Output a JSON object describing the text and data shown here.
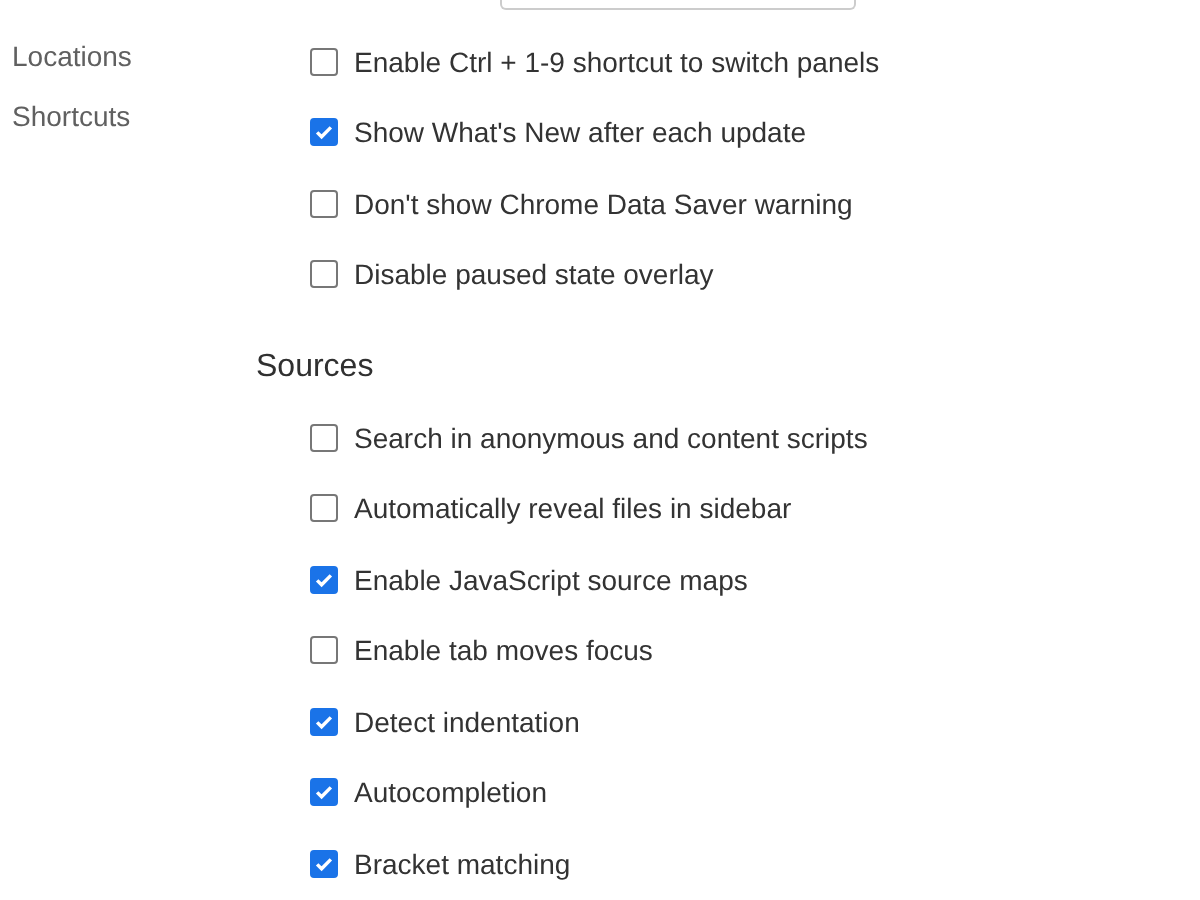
{
  "sidebar": {
    "items": [
      {
        "label": "Locations"
      },
      {
        "label": "Shortcuts"
      }
    ]
  },
  "sections": [
    {
      "options": [
        {
          "label": "Enable Ctrl + 1-9 shortcut to switch panels",
          "checked": false
        },
        {
          "label": "Show What's New after each update",
          "checked": true
        },
        {
          "label": "Don't show Chrome Data Saver warning",
          "checked": false
        },
        {
          "label": "Disable paused state overlay",
          "checked": false
        }
      ]
    },
    {
      "title": "Sources",
      "options": [
        {
          "label": "Search in anonymous and content scripts",
          "checked": false
        },
        {
          "label": "Automatically reveal files in sidebar",
          "checked": false
        },
        {
          "label": "Enable JavaScript source maps",
          "checked": true
        },
        {
          "label": "Enable tab moves focus",
          "checked": false
        },
        {
          "label": "Detect indentation",
          "checked": true
        },
        {
          "label": "Autocompletion",
          "checked": true
        },
        {
          "label": "Bracket matching",
          "checked": true
        }
      ]
    }
  ]
}
